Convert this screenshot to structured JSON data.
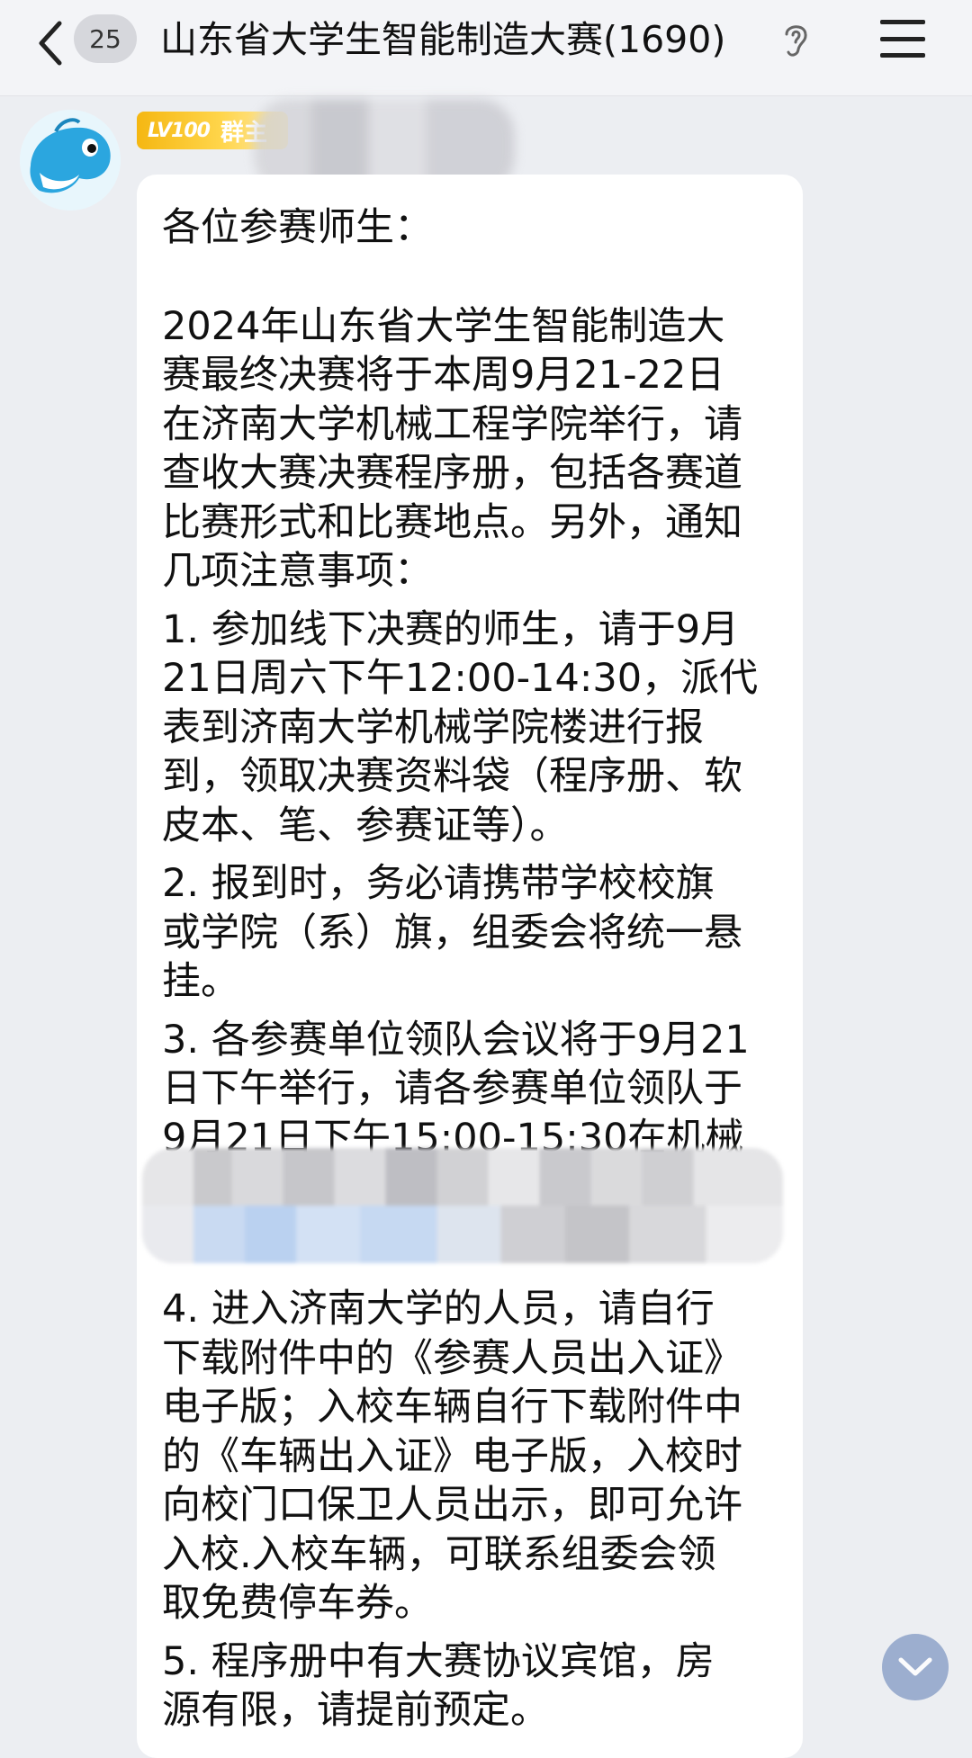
{
  "header": {
    "unread_count": "25",
    "title": "山东省大学生智能制造大赛(1690)",
    "icons": [
      "back-arrow-icon",
      "ear-icon",
      "menu-icon"
    ]
  },
  "sender": {
    "level": "LV100",
    "role": "群主",
    "avatar": "dolphin-avatar-icon",
    "tag_color": "#f5b712"
  },
  "message": {
    "greeting": "各位参赛师生：",
    "intro_lines": [
      "2024年山东省大学生智能制造大",
      "赛最终决赛将于本周9月21-22日",
      "在济南大学机械工程学院举行，请",
      "查收大赛决赛程序册，包括各赛道",
      "比赛形式和比赛地点。另外，通知",
      "几项注意事项："
    ],
    "item1_lines": [
      "1. 参加线下决赛的师生，请于9月",
      "21日周六下午12:00-14:30，派代",
      "表到济南大学机械学院楼进行报",
      "到，领取决赛资料袋（程序册、软",
      "皮本、笔、参赛证等）。"
    ],
    "item2_lines": [
      "2. 报到时，务必请携带学校校旗",
      "或学院（系）旗，组委会将统一悬",
      "挂。"
    ],
    "item3_lines": [
      "3. 各参赛单位领队会议将于9月21",
      "日下午举行，请各参赛单位领队于",
      "9月21日下午15:00-15:30在机械"
    ],
    "item4_lines": [
      "4. 进入济南大学的人员，请自行",
      "下载附件中的《参赛人员出入证》",
      "电子版；入校车辆自行下载附件中",
      "的《车辆出入证》电子版，入校时",
      "向校门口保卫人员出示，即可允许",
      "入校.入校车辆，可联系组委会领",
      "取免费停车券。"
    ],
    "item5_lines": [
      "5. 程序册中有大赛协议宾馆，房",
      "源有限，请提前预定。"
    ]
  },
  "scroll_button": {
    "icon": "chevron-down-icon"
  }
}
